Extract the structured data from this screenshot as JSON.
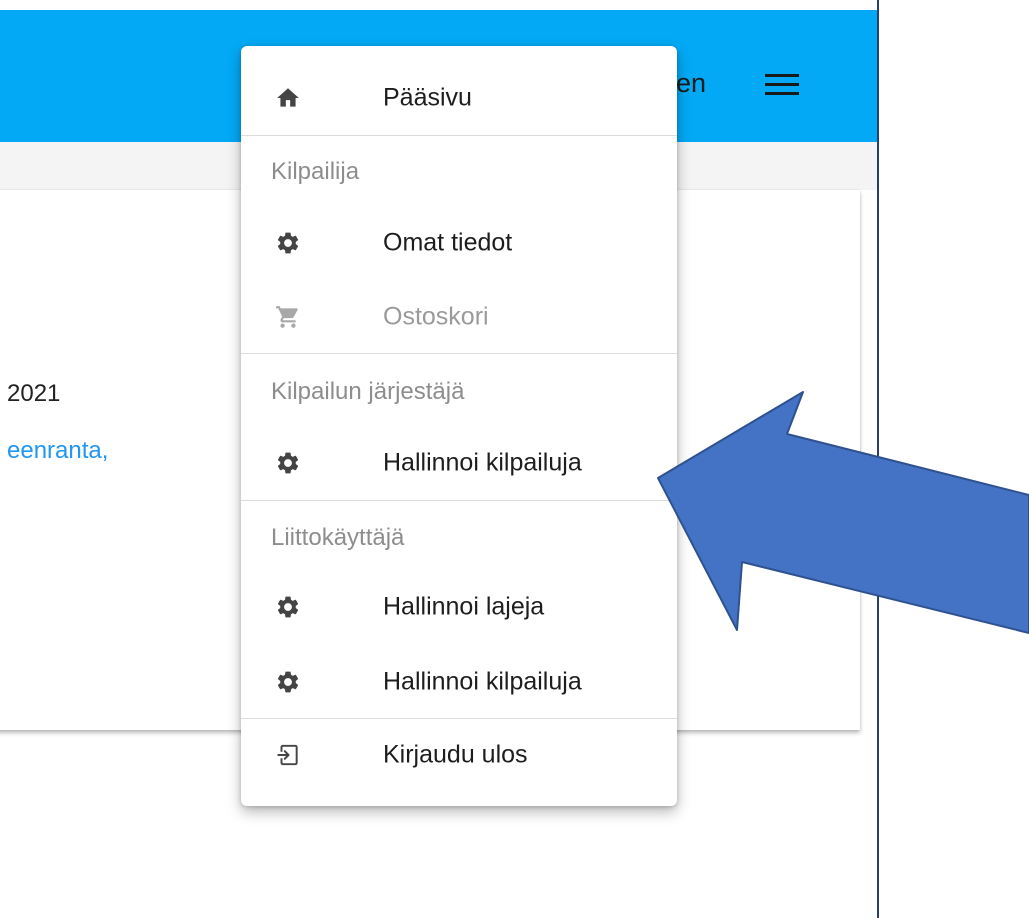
{
  "header": {
    "user_name_partial": "en",
    "menu_icon": "hamburger-icon"
  },
  "content": {
    "year_partial": "2021",
    "location_partial": "eenranta,"
  },
  "menu": {
    "home": {
      "label": "Pääsivu",
      "icon": "home-icon"
    },
    "section_competitor": "Kilpailija",
    "own_info": {
      "label": "Omat tiedot",
      "icon": "gear-icon"
    },
    "cart": {
      "label": "Ostoskori",
      "icon": "cart-icon",
      "disabled": true
    },
    "section_organizer": "Kilpailun järjestäjä",
    "organizer_manage_competitions": {
      "label": "Hallinnoi kilpailuja",
      "icon": "gear-icon"
    },
    "section_federation": "Liittokäyttäjä",
    "manage_sports": {
      "label": "Hallinnoi lajeja",
      "icon": "gear-icon"
    },
    "federation_manage_competitions": {
      "label": "Hallinnoi kilpailuja",
      "icon": "gear-icon"
    },
    "logout": {
      "label": "Kirjaudu ulos",
      "icon": "logout-icon"
    }
  },
  "colors": {
    "app_bar": "#03a9f4",
    "link": "#2196f3",
    "annotation_arrow": "#4472c4",
    "annotation_arrow_border": "#2f528f"
  }
}
